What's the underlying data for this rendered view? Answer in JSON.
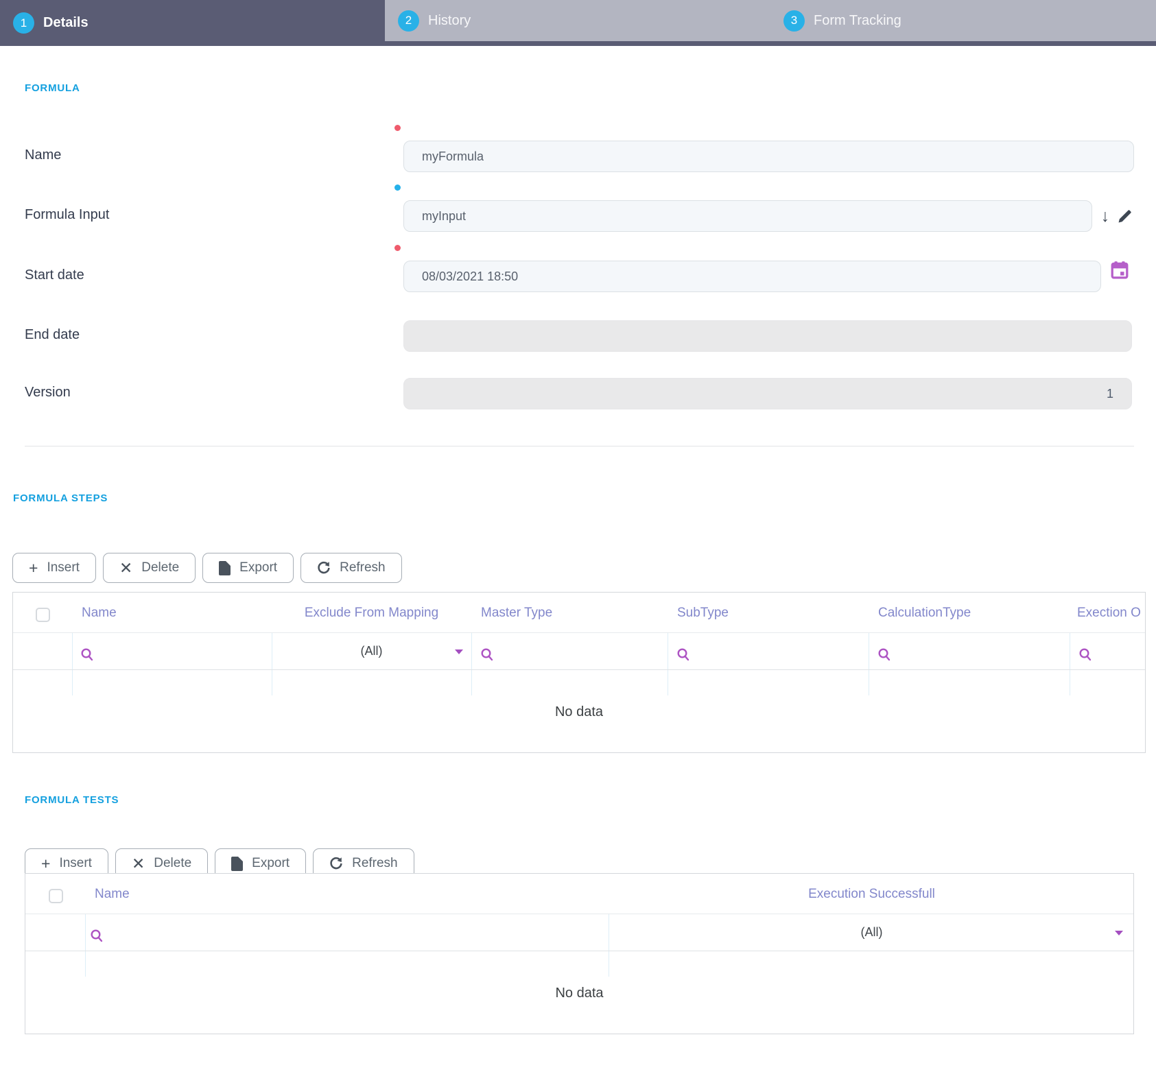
{
  "tabs": [
    {
      "number": "1",
      "label": "Details",
      "active": true
    },
    {
      "number": "2",
      "label": "History",
      "active": false
    },
    {
      "number": "3",
      "label": "Form Tracking",
      "active": false
    }
  ],
  "formula": {
    "heading": "FORMULA",
    "name": {
      "label": "Name",
      "value": "myFormula"
    },
    "input": {
      "label": "Formula Input",
      "value": "myInput"
    },
    "start_date": {
      "label": "Start date",
      "value": "08/03/2021 18:50"
    },
    "end_date": {
      "label": "End date",
      "value": ""
    },
    "version": {
      "label": "Version",
      "value": "1"
    }
  },
  "steps": {
    "heading": "FORMULA STEPS",
    "toolbar": {
      "insert": "Insert",
      "delete": "Delete",
      "export": "Export",
      "refresh": "Refresh"
    },
    "columns": [
      "Name",
      "Exclude From Mapping",
      "Master Type",
      "SubType",
      "CalculationType",
      "Exection O"
    ],
    "filter_all": "(All)",
    "no_data": "No data"
  },
  "tests": {
    "heading": "FORMULA TESTS",
    "toolbar": {
      "insert": "Insert",
      "delete": "Delete",
      "export": "Export",
      "refresh": "Refresh"
    },
    "columns": [
      "Name",
      "Execution Successfull"
    ],
    "filter_all": "(All)",
    "no_data": "No data"
  },
  "colors": {
    "accent_blue": "#14a0df",
    "tab_active_bg": "#5a5c74",
    "tab_inactive_bg": "#b3b5c1",
    "step_circle_blue": "#29b1e7",
    "required_red": "#ef5b6c",
    "required_blue": "#25b1ea",
    "grid_header_text": "#8287cb",
    "search_icon_purple": "#ad53c3",
    "calendar_icon_purple": "#b55fc9"
  }
}
